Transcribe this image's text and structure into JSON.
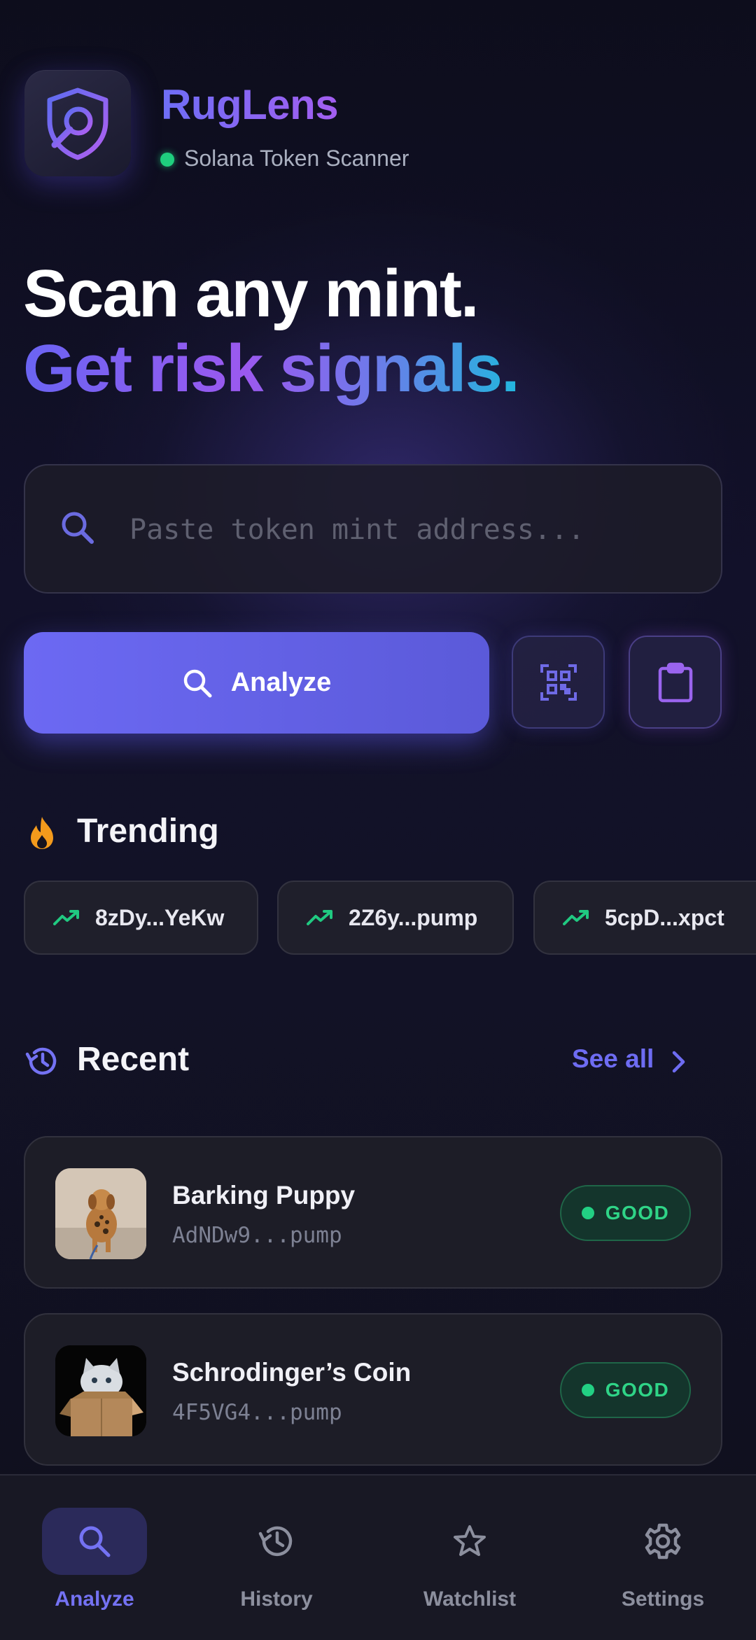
{
  "header": {
    "app_name": "RugLens",
    "subtitle": "Solana Token Scanner",
    "status_color": "#1fcf7e"
  },
  "hero": {
    "line1": "Scan any mint.",
    "line2": "Get risk signals."
  },
  "search": {
    "placeholder": "Paste token mint address...",
    "value": ""
  },
  "actions": {
    "analyze_label": "Analyze",
    "icons": [
      "search-icon",
      "qr-scan-icon",
      "clipboard-icon"
    ]
  },
  "trending": {
    "title": "Trending",
    "chips": [
      {
        "label": "8zDy...YeKw"
      },
      {
        "label": "2Z6y...pump"
      },
      {
        "label": "5cpD...xpct"
      }
    ]
  },
  "recent": {
    "title": "Recent",
    "see_all": "See all",
    "items": [
      {
        "name": "Barking Puppy",
        "address": "AdNDw9...pump",
        "status": "GOOD"
      },
      {
        "name": "Schrodinger’s Coin",
        "address": "4F5VG4...pump",
        "status": "GOOD"
      }
    ]
  },
  "nav": {
    "items": [
      {
        "label": "Analyze",
        "active": true
      },
      {
        "label": "History",
        "active": false
      },
      {
        "label": "Watchlist",
        "active": false
      },
      {
        "label": "Settings",
        "active": false
      }
    ]
  },
  "colors": {
    "accent": "#6c69f3",
    "good": "#2fd487",
    "background": "#12112a"
  }
}
